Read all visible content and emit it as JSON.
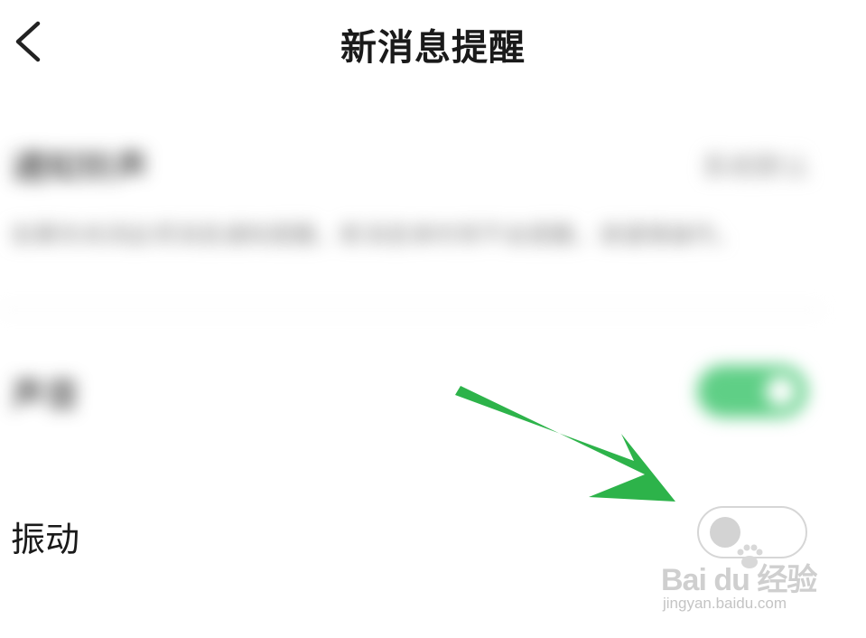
{
  "header": {
    "title": "新消息提醒",
    "back_icon": "chevron-left-icon"
  },
  "settings": {
    "rows": [
      {
        "label": "通知铃声",
        "value": "系统默认",
        "description": "如果你关闭此项消息通知提醒，新消息来时将不会提醒，请谨慎操作。",
        "blurred": true
      },
      {
        "label": "声音",
        "toggle_on": true,
        "blurred": true
      },
      {
        "label": "振动",
        "toggle_on": false,
        "blurred": false
      }
    ]
  },
  "annotation": {
    "arrow_color": "#2db34a",
    "points_to": "vibration-toggle"
  },
  "watermark": {
    "logo": "Bai du 经验",
    "url": "jingyan.baidu.com"
  },
  "colors": {
    "toggle_on": "#5fcf86",
    "toggle_off_track": "#ffffff",
    "toggle_off_knob": "#d3d3d3",
    "arrow": "#2db34a"
  }
}
